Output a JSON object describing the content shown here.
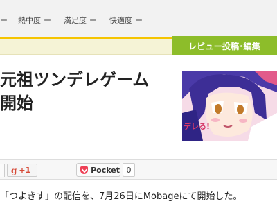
{
  "header": {
    "metrics": [
      {
        "label": "ー",
        "dash": ""
      },
      {
        "label": "熱中度",
        "dash": "ー"
      },
      {
        "label": "満足度",
        "dash": "ー"
      },
      {
        "label": "快適度",
        "dash": "ー"
      }
    ],
    "review_button": "レビュー投稿･編集"
  },
  "article": {
    "title_line1": "元祖ツンデレゲーム",
    "title_line2": "開始",
    "thumbnail_text": "デレる!",
    "body_text": "「つよきす」の配信を、7月26日にMobageにて開始した。"
  },
  "share": {
    "gplus_label": "+1",
    "pocket_label": "Pocket",
    "pocket_count": "0"
  },
  "colors": {
    "accent_green": "#8dbd2a",
    "accent_yellow": "#f5c400",
    "pocket_red": "#ee4056"
  }
}
